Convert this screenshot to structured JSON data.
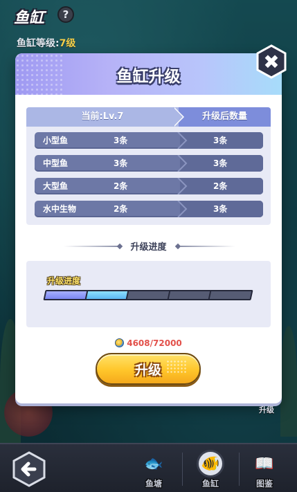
{
  "header": {
    "title": "鱼缸",
    "help_icon": "?",
    "level_label": "鱼缸等级:",
    "level_value": "7级"
  },
  "modal": {
    "title": "鱼缸升级",
    "close_icon": "✖",
    "table": {
      "current_header": "当前:Lv.7",
      "after_header": "升级后数量",
      "rows": [
        {
          "name": "小型鱼",
          "current": "3条",
          "after": "3条"
        },
        {
          "name": "中型鱼",
          "current": "3条",
          "after": "3条"
        },
        {
          "name": "大型鱼",
          "current": "2条",
          "after": "2条"
        },
        {
          "name": "水中生物",
          "current": "2条",
          "after": "3条"
        }
      ]
    },
    "progress_section_title": "升级进度",
    "progress_label": "升级进度",
    "progress": {
      "filled_segments": 2,
      "total_segments": 5
    },
    "cost_text": "4608/72000",
    "upgrade_button": "升级"
  },
  "side_label": "升级",
  "bottom_nav": {
    "back_icon": "arrow-left-icon",
    "items": [
      {
        "label": "鱼塘",
        "icon": "fish-pond-icon",
        "active": false
      },
      {
        "label": "鱼缸",
        "icon": "fish-bowl-icon",
        "active": true
      },
      {
        "label": "图鉴",
        "icon": "book-icon",
        "active": false
      }
    ]
  },
  "colors": {
    "header_gradient_start": "#9f9af2",
    "header_gradient_end": "#a7dcfa",
    "row_bg": "#6d78a6",
    "cost_text": "#e2504a",
    "button_yellow": "#ffc62a"
  }
}
